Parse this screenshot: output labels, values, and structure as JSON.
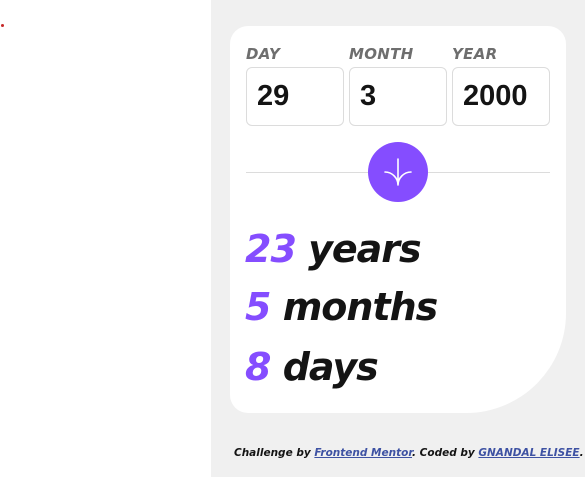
{
  "form": {
    "day": {
      "label": "DAY",
      "value": "29"
    },
    "month": {
      "label": "MONTH",
      "value": "3"
    },
    "year": {
      "label": "YEAR",
      "value": "2000"
    }
  },
  "submit": {
    "icon": "arrow-down-icon",
    "accent": "#854dff"
  },
  "results": {
    "years": {
      "number": "23",
      "unit": "years"
    },
    "months": {
      "number": "5",
      "unit": "months"
    },
    "days": {
      "number": "8",
      "unit": "days"
    }
  },
  "footer": {
    "prefix": "Challenge by",
    "mentor_link": "Frontend Mentor",
    "middle": ". Coded by",
    "author_link": "GNANDAL ELISEE",
    "suffix": "."
  },
  "colors": {
    "accent": "#854dff",
    "panel_bg": "#f0f0f0",
    "card_bg": "#ffffff",
    "text": "#141414",
    "label": "#6e6e6e",
    "link": "#3e52a3"
  }
}
